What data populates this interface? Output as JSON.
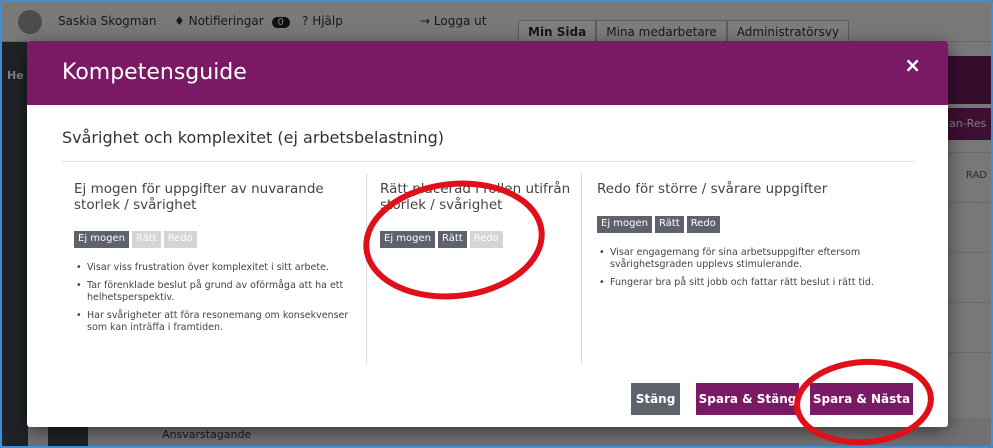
{
  "topbar": {
    "user": "Saskia Skogman",
    "notifications_label": "Notifieringar",
    "notifications_count": "0",
    "help": "Hjälp",
    "logout": "Logga ut",
    "tabs": [
      "Min Sida",
      "Mina medarbetare",
      "Administratörsvy"
    ]
  },
  "background": {
    "side_label": "He",
    "right_button": "an-Res",
    "right_col": "RAD",
    "row_label": "Ansvarstagande"
  },
  "modal": {
    "title": "Kompetensguide",
    "close_glyph": "×",
    "section_title": "Svårighet och komplexitet (ej arbetsbelastning)",
    "columns": [
      {
        "heading": "Ej mogen för uppgifter av nuvarande storlek / svårighet",
        "levels": [
          {
            "label": "Ej mogen",
            "active": true
          },
          {
            "label": "Rätt",
            "active": false
          },
          {
            "label": "Redo",
            "active": false
          }
        ],
        "bullets": [
          "Visar viss frustration över komplexitet i sitt arbete.",
          "Tar förenklade beslut på grund av oförmåga att ha ett helhetsperspektiv.",
          "Har svårigheter att föra resonemang om konsekvenser som kan inträffa i framtiden."
        ]
      },
      {
        "heading": "Rätt placerad i rollen utifrån storlek / svårighet",
        "levels": [
          {
            "label": "Ej mogen",
            "active": true
          },
          {
            "label": "Rätt",
            "active": true
          },
          {
            "label": "Redo",
            "active": false
          }
        ],
        "bullets": []
      },
      {
        "heading": "Redo för större / svårare uppgifter",
        "levels": [
          {
            "label": "Ej mogen",
            "active": true
          },
          {
            "label": "Rätt",
            "active": true
          },
          {
            "label": "Redo",
            "active": true
          }
        ],
        "bullets": [
          "Visar engagemang för sina arbetsuppgifter eftersom svårighetsgraden upplevs stimulerande.",
          "Fungerar bra på sitt jobb och fattar rätt beslut i rätt tid."
        ]
      }
    ],
    "buttons": {
      "close": "Stäng",
      "save_close": "Spara & Stäng",
      "save_next": "Spara & Nästa"
    }
  },
  "colors": {
    "brand_purple": "#7b1a64",
    "level_active": "#5d626b",
    "level_inactive": "#d5d5d5",
    "annotation_red": "#e0101a"
  }
}
